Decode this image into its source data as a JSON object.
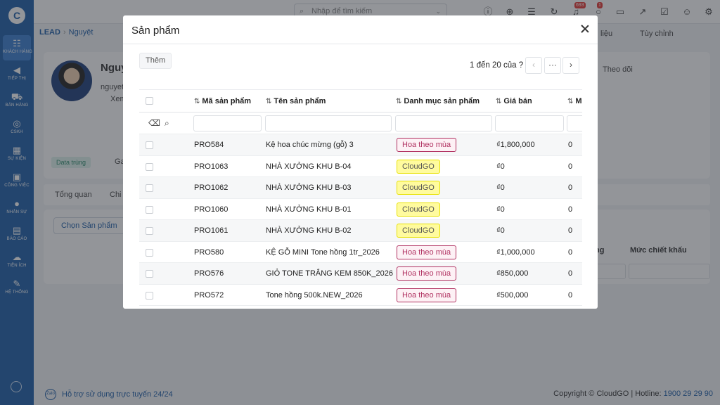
{
  "sidebar": {
    "items": [
      {
        "label": "KHÁCH HÀNG",
        "icon": "users-icon"
      },
      {
        "label": "TIẾP THỊ",
        "icon": "megaphone-icon"
      },
      {
        "label": "BÁN HÀNG",
        "icon": "cart-icon"
      },
      {
        "label": "CSKH",
        "icon": "support-icon"
      },
      {
        "label": "SỰ KIỆN",
        "icon": "calendar-icon"
      },
      {
        "label": "CÔNG VIỆC",
        "icon": "briefcase-icon"
      },
      {
        "label": "NHÂN SỰ",
        "icon": "person-icon"
      },
      {
        "label": "BÁO CÁO",
        "icon": "report-icon"
      },
      {
        "label": "TIỆN ÍCH",
        "icon": "utilities-icon"
      },
      {
        "label": "HỆ THỐNG",
        "icon": "wrench-icon"
      }
    ]
  },
  "topbar": {
    "search_placeholder": "Nhập để tìm kiếm",
    "notification_count": "693",
    "chat_count": "1"
  },
  "breadcrumb": {
    "module": "LEAD",
    "record": "Nguyệt"
  },
  "background": {
    "name": "Nguy",
    "email": "nguyet",
    "view": "Xem",
    "tag": "Data trùng",
    "tag2": "Ga",
    "tabs": [
      "Tổng quan",
      "Chi"
    ],
    "choose_product": "Chọn Sản phẩm",
    "follow": "Theo dõi",
    "customize": "Tùy chỉnh",
    "data_link": "liệu",
    "col_partial": "ng",
    "col_discount": "Mức chiết khấu"
  },
  "modal": {
    "title": "Sản phẩm",
    "add_button": "Thêm",
    "pagination": "1 đến 20 của ?",
    "more": "···",
    "columns": [
      "Mã sản phẩm",
      "Tên sản phẩm",
      "Danh mục sản phẩm",
      "Giá bán",
      "M"
    ],
    "rows": [
      {
        "code": "PRO584",
        "name": "Kệ hoa chúc mừng (gỗ) 3",
        "category": "Hoa theo mùa",
        "price": "₫1,800,000",
        "extra": "0"
      },
      {
        "code": "PRO1063",
        "name": "NHÀ XƯỞNG KHU B-04",
        "category": "CloudGO",
        "price": "₫0",
        "extra": "0"
      },
      {
        "code": "PRO1062",
        "name": "NHÀ XƯỞNG KHU B-03",
        "category": "CloudGO",
        "price": "₫0",
        "extra": "0"
      },
      {
        "code": "PRO1060",
        "name": "NHÀ XƯỞNG KHU B-01",
        "category": "CloudGO",
        "price": "₫0",
        "extra": "0"
      },
      {
        "code": "PRO1061",
        "name": "NHÀ XƯỞNG KHU B-02",
        "category": "CloudGO",
        "price": "₫0",
        "extra": "0"
      },
      {
        "code": "PRO580",
        "name": "KỆ GỖ MINI Tone hồng 1tr_2026",
        "category": "Hoa theo mùa",
        "price": "₫1,000,000",
        "extra": "0"
      },
      {
        "code": "PRO576",
        "name": "GIỎ TONE TRẮNG KEM 850K_2026",
        "category": "Hoa theo mùa",
        "price": "₫850,000",
        "extra": "0"
      },
      {
        "code": "PRO572",
        "name": "Tone hồng 500k.NEW_2026",
        "category": "Hoa theo mùa",
        "price": "₫500,000",
        "extra": "0"
      }
    ]
  },
  "footer": {
    "support": "Hỗ trợ sử dụng trực tuyến 24/24",
    "copyright": "Copyright © CloudGO | Hotline:",
    "hotline": "1900 29 29 90"
  },
  "colors": {
    "sidebar": "#1f5fa8",
    "pink_tag": "#b03060",
    "yellow_tag": "#fffb9e"
  }
}
